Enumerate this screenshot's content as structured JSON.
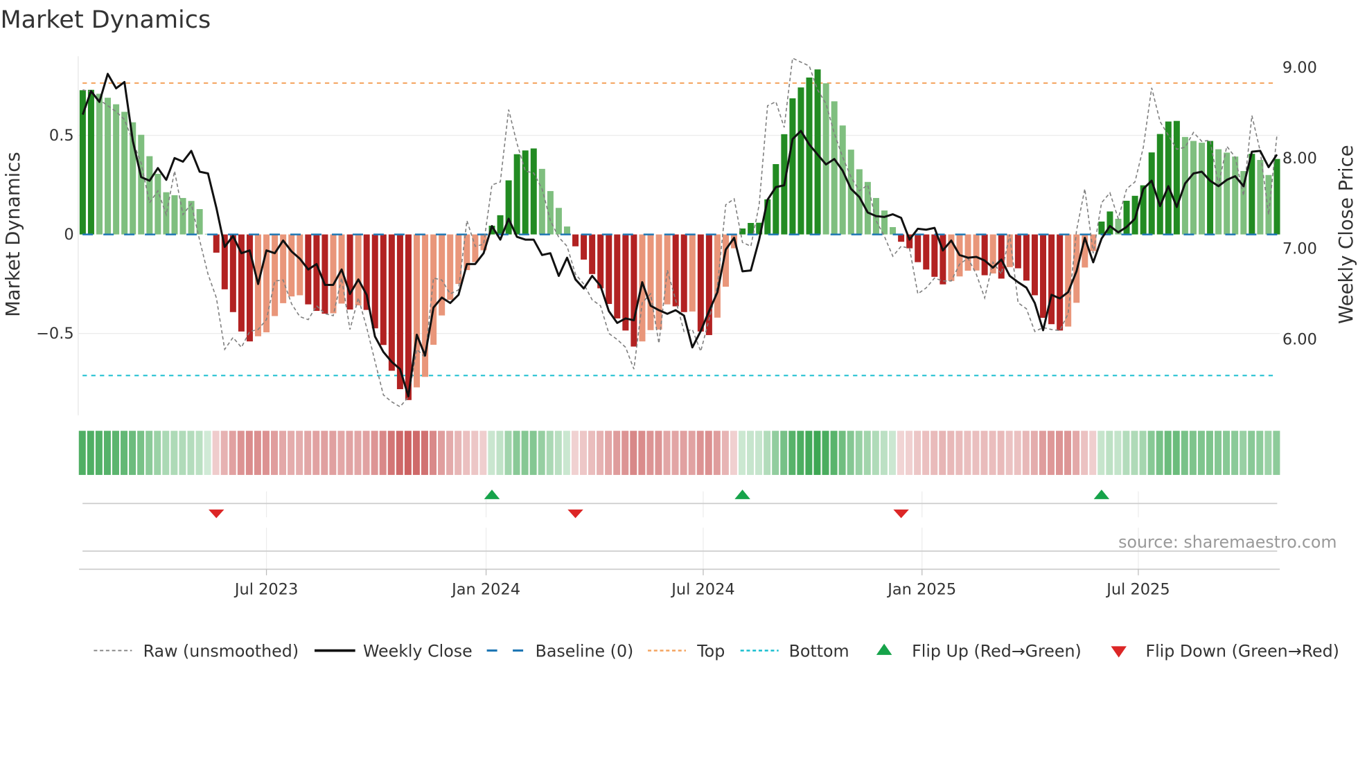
{
  "chart_data": {
    "type": "bar",
    "title": "Market Dynamics",
    "ylabel": "Market Dynamics",
    "ylabel_right": "Weekly Close Price",
    "ylim": [
      -0.9,
      0.9
    ],
    "ylim_right": [
      5.2,
      9.1
    ],
    "yticks": [
      {
        "v": 0.5,
        "label": "0.5"
      },
      {
        "v": 0,
        "label": "0"
      },
      {
        "v": -0.5,
        "label": "−0.5"
      }
    ],
    "yticks_right": [
      {
        "v": 9,
        "label": "9.00"
      },
      {
        "v": 8,
        "label": "8.00"
      },
      {
        "v": 7,
        "label": "7.00"
      },
      {
        "v": 6,
        "label": "6.00"
      }
    ],
    "xticks": [
      {
        "week": 23,
        "label": "Jul 2023"
      },
      {
        "week": 49.3,
        "label": "Jan 2024"
      },
      {
        "week": 75.3,
        "label": "Jul 2024"
      },
      {
        "week": 101.5,
        "label": "Jan 2025"
      },
      {
        "week": 127.4,
        "label": "Jul 2025"
      }
    ],
    "top_level": 0.764,
    "bottom_level": -0.712,
    "baseline": 0,
    "momentum": [
      0.728,
      0.73,
      0.71,
      0.69,
      0.657,
      0.619,
      0.566,
      0.503,
      0.395,
      0.306,
      0.213,
      0.198,
      0.184,
      0.169,
      0.128,
      0.003,
      -0.092,
      -0.277,
      -0.392,
      -0.49,
      -0.54,
      -0.514,
      -0.494,
      -0.412,
      -0.347,
      -0.313,
      -0.307,
      -0.353,
      -0.386,
      -0.4,
      -0.398,
      -0.349,
      -0.379,
      -0.358,
      -0.381,
      -0.474,
      -0.558,
      -0.688,
      -0.781,
      -0.836,
      -0.772,
      -0.719,
      -0.557,
      -0.409,
      -0.33,
      -0.25,
      -0.18,
      -0.14,
      -0.08,
      0.044,
      0.097,
      0.273,
      0.405,
      0.424,
      0.434,
      0.331,
      0.219,
      0.134,
      0.04,
      -0.06,
      -0.127,
      -0.2,
      -0.272,
      -0.351,
      -0.424,
      -0.485,
      -0.566,
      -0.54,
      -0.483,
      -0.48,
      -0.353,
      -0.363,
      -0.392,
      -0.389,
      -0.49,
      -0.508,
      -0.42,
      -0.264,
      -0.07,
      0.03,
      0.058,
      0.059,
      0.177,
      0.355,
      0.506,
      0.687,
      0.742,
      0.792,
      0.833,
      0.763,
      0.672,
      0.55,
      0.428,
      0.329,
      0.265,
      0.184,
      0.121,
      0.037,
      -0.037,
      -0.07,
      -0.14,
      -0.177,
      -0.214,
      -0.252,
      -0.235,
      -0.212,
      -0.183,
      -0.182,
      -0.206,
      -0.197,
      -0.223,
      -0.165,
      -0.171,
      -0.233,
      -0.307,
      -0.421,
      -0.453,
      -0.485,
      -0.465,
      -0.345,
      -0.167,
      -0.084,
      0.065,
      0.116,
      0.079,
      0.17,
      0.195,
      0.248,
      0.414,
      0.507,
      0.57,
      0.573,
      0.492,
      0.472,
      0.463,
      0.472,
      0.43,
      0.413,
      0.393,
      0.32,
      0.407,
      0.376,
      0.3,
      0.381
    ],
    "raw": [
      0.73,
      0.72,
      0.68,
      0.65,
      0.62,
      0.58,
      0.47,
      0.36,
      0.16,
      0.22,
      0.1,
      0.32,
      0.1,
      0.155,
      -0.03,
      -0.2,
      -0.32,
      -0.58,
      -0.52,
      -0.57,
      -0.49,
      -0.48,
      -0.43,
      -0.235,
      -0.23,
      -0.35,
      -0.415,
      -0.43,
      -0.36,
      -0.4,
      -0.41,
      -0.22,
      -0.48,
      -0.32,
      -0.47,
      -0.64,
      -0.81,
      -0.845,
      -0.87,
      -0.82,
      -0.58,
      -0.62,
      -0.22,
      -0.23,
      -0.3,
      -0.28,
      0.07,
      -0.06,
      -0.05,
      0.25,
      0.265,
      0.63,
      0.46,
      0.32,
      0.31,
      0.23,
      0.07,
      -0.014,
      -0.06,
      -0.2,
      -0.25,
      -0.33,
      -0.36,
      -0.5,
      -0.53,
      -0.57,
      -0.68,
      -0.345,
      -0.3,
      -0.55,
      -0.18,
      -0.33,
      -0.49,
      -0.48,
      -0.59,
      -0.43,
      -0.26,
      0.15,
      0.18,
      -0.04,
      -0.06,
      0.15,
      0.65,
      0.67,
      0.54,
      0.89,
      0.87,
      0.85,
      0.73,
      0.66,
      0.51,
      0.39,
      0.29,
      0.22,
      0.25,
      0.07,
      -0.01,
      -0.11,
      -0.06,
      -0.07,
      -0.3,
      -0.27,
      -0.22,
      -0.235,
      -0.235,
      -0.15,
      -0.12,
      -0.2,
      -0.32,
      -0.14,
      -0.2,
      0,
      -0.345,
      -0.375,
      -0.49,
      -0.47,
      -0.48,
      -0.485,
      -0.4,
      0.02,
      0.23,
      -0.095,
      0.16,
      0.21,
      0.08,
      0.23,
      0.265,
      0.44,
      0.74,
      0.57,
      0.5,
      0.43,
      0.44,
      0.515,
      0.47,
      0.475,
      0.25,
      0.445,
      0.39,
      0.195,
      0.6,
      0.42,
      0.1,
      0.5
    ],
    "weekly_close": [
      8.47,
      8.73,
      8.61,
      8.92,
      8.76,
      8.83,
      8.18,
      7.78,
      7.74,
      7.88,
      7.75,
      7.99,
      7.95,
      8.07,
      7.84,
      7.82,
      7.44,
      7.01,
      7.13,
      6.94,
      6.97,
      6.6,
      6.97,
      6.94,
      7.08,
      6.96,
      6.88,
      6.76,
      6.82,
      6.59,
      6.59,
      6.76,
      6.49,
      6.65,
      6.48,
      6.02,
      5.85,
      5.74,
      5.66,
      5.36,
      6.04,
      5.81,
      6.34,
      6.45,
      6.39,
      6.48,
      6.82,
      6.82,
      6.94,
      7.24,
      7.09,
      7.32,
      7.12,
      7.09,
      7.09,
      6.92,
      6.94,
      6.69,
      6.89,
      6.65,
      6.55,
      6.69,
      6.58,
      6.3,
      6.17,
      6.22,
      6.2,
      6.62,
      6.36,
      6.31,
      6.27,
      6.31,
      6.25,
      5.9,
      6.08,
      6.3,
      6.51,
      6.98,
      7.11,
      6.74,
      6.75,
      7.09,
      7.53,
      7.67,
      7.69,
      8.2,
      8.29,
      8.14,
      8.03,
      7.92,
      7.98,
      7.85,
      7.65,
      7.56,
      7.39,
      7.35,
      7.34,
      7.37,
      7.33,
      7.09,
      7.21,
      7.2,
      7.22,
      6.97,
      7.08,
      6.92,
      6.89,
      6.9,
      6.86,
      6.78,
      6.87,
      6.69,
      6.62,
      6.56,
      6.39,
      6.09,
      6.48,
      6.44,
      6.51,
      6.74,
      7.11,
      6.84,
      7.1,
      7.24,
      7.17,
      7.23,
      7.32,
      7.65,
      7.74,
      7.46,
      7.68,
      7.45,
      7.71,
      7.82,
      7.84,
      7.74,
      7.68,
      7.75,
      7.79,
      7.68,
      8.06,
      8.07,
      7.89,
      8.03
    ],
    "flips_up": [
      50,
      80,
      123
    ],
    "flips_down": [
      17,
      60,
      99
    ],
    "colors": {
      "strong_up": "#228b22",
      "weak_up": "#7fbf7f",
      "strong_down": "#b22222",
      "weak_down": "#e9967a",
      "baseline": "#1f77b4",
      "top": "#f4a460",
      "bottom": "#17becf",
      "close": "#111111",
      "raw": "#808080",
      "flip_up": "#16a34a",
      "flip_down": "#dc2626"
    },
    "legend": {
      "placement": "bottom",
      "raw": "Raw (unsmoothed)",
      "close": "Weekly Close",
      "baseline": "Baseline (0)",
      "top": "Top",
      "bottom": "Bottom",
      "flip_up": "Flip Up (Red→Green)",
      "flip_down": "Flip Down (Green→Red)"
    }
  },
  "source": "source: sharemaestro.com"
}
